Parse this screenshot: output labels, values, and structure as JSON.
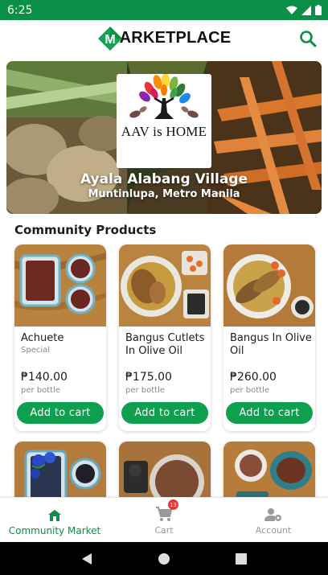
{
  "status_bar": {
    "time": "6:25"
  },
  "app": {
    "title": "ARKETPLACE",
    "logo_letter": "M"
  },
  "hero": {
    "logo_text": "AAV is HOME",
    "title": "Ayala Alabang Village",
    "subtitle": "Muntinlupa, Metro Manila"
  },
  "section": {
    "title": "Community Products"
  },
  "products": [
    {
      "name": "Achuete",
      "sub": "Special",
      "price": "₱140.00",
      "unit": "per bottle",
      "button": "Add to cart"
    },
    {
      "name": "Bangus Cutlets In Olive Oil",
      "sub": "",
      "price": "₱175.00",
      "unit": "per bottle",
      "button": "Add to cart"
    },
    {
      "name": "Bangus In Olive Oil",
      "sub": "",
      "price": "₱260.00",
      "unit": "per bottle",
      "button": "Add to cart"
    }
  ],
  "bottom_nav": {
    "items": [
      {
        "label": "Community Market",
        "icon": "store-icon",
        "active": true
      },
      {
        "label": "Cart",
        "icon": "cart-icon",
        "badge": "13"
      },
      {
        "label": "Account",
        "icon": "account-settings-icon"
      }
    ]
  },
  "colors": {
    "primary": "#0b8f47",
    "button": "#0ea04f",
    "badge": "#e53935"
  }
}
